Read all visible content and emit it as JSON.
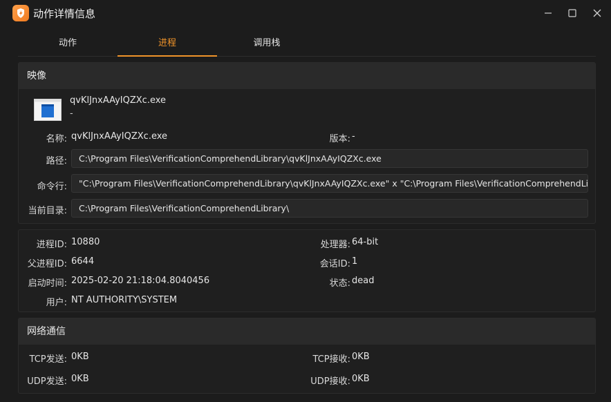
{
  "window": {
    "title": "动作详情信息",
    "accent": "#f0942a"
  },
  "tabs": [
    {
      "label": "动作"
    },
    {
      "label": "进程"
    },
    {
      "label": "调用栈"
    }
  ],
  "image_section": {
    "title": "映像",
    "file_name": "qvKlJnxAAyIQZXc.exe",
    "file_subtitle": "-",
    "name_label": "名称:",
    "name_value": "qvKlJnxAAyIQZXc.exe",
    "version_label": "版本:",
    "version_value": "-",
    "path_label": "路径:",
    "path_value": "C:\\Program Files\\VerificationComprehendLibrary\\qvKlJnxAAyIQZXc.exe",
    "cmd_label": "命令行:",
    "cmd_value": "\"C:\\Program Files\\VerificationComprehendLibrary\\qvKlJnxAAyIQZXc.exe\"  x \"C:\\Program Files\\VerificationComprehendLibrary\\",
    "cwd_label": "当前目录:",
    "cwd_value": "C:\\Program Files\\VerificationComprehendLibrary\\"
  },
  "process_section": {
    "pid_label": "进程ID:",
    "pid_value": "10880",
    "ppid_label": "父进程ID:",
    "ppid_value": "6644",
    "start_label": "启动时间:",
    "start_value": "2025-02-20 21:18:04.8040456",
    "user_label": "用户:",
    "user_value": "NT AUTHORITY\\SYSTEM",
    "arch_label": "处理器:",
    "arch_value": "64-bit",
    "session_label": "会话ID:",
    "session_value": "1",
    "state_label": "状态:",
    "state_value": "dead"
  },
  "network_section": {
    "title": "网络通信",
    "tcp_send_label": "TCP发送:",
    "tcp_send_value": "0KB",
    "tcp_recv_label": "TCP接收:",
    "tcp_recv_value": "0KB",
    "udp_send_label": "UDP发送:",
    "udp_send_value": "0KB",
    "udp_recv_label": "UDP接收:",
    "udp_recv_value": "0KB"
  }
}
